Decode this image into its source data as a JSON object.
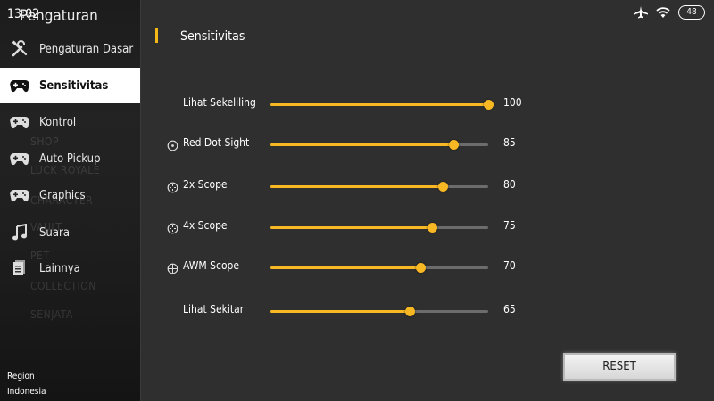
{
  "status_bar": {
    "time": "13:02",
    "battery": "48",
    "icons": [
      "airplane-icon",
      "wifi-icon",
      "battery-icon"
    ]
  },
  "sidebar": {
    "title": "Pengaturan",
    "background_texts": [
      "SHOP",
      "LUCK ROYALE",
      "CHARACTER",
      "VAULT",
      "PET",
      "COLLECTION",
      "SENJATA"
    ],
    "items": [
      {
        "label": "Pengaturan Dasar",
        "icon": "tools-icon",
        "active": false
      },
      {
        "label": "Sensitivitas",
        "icon": "gamepad-icon",
        "active": true
      },
      {
        "label": "Kontrol",
        "icon": "gamepad-icon",
        "active": false
      },
      {
        "label": "Auto Pickup",
        "icon": "gamepad-icon",
        "active": false
      },
      {
        "label": "Graphics",
        "icon": "gamepad-icon",
        "active": false
      },
      {
        "label": "Suara",
        "icon": "music-note-icon",
        "active": false
      },
      {
        "label": "Lainnya",
        "icon": "document-icon",
        "active": false
      }
    ],
    "region_label": "Region",
    "region_value": "Indonesia"
  },
  "main": {
    "section_title": "Sensitivitas",
    "sliders": [
      {
        "label": "Lihat Sekeliling",
        "value": "100",
        "fraction": 1.0,
        "icon": null
      },
      {
        "label": "Red Dot Sight",
        "value": "85",
        "fraction": 0.84,
        "icon": "red-dot-sight-icon"
      },
      {
        "label": "2x Scope",
        "value": "80",
        "fraction": 0.79,
        "icon": "scope-icon"
      },
      {
        "label": "4x Scope",
        "value": "75",
        "fraction": 0.74,
        "icon": "scope-icon"
      },
      {
        "label": "AWM Scope",
        "value": "70",
        "fraction": 0.69,
        "icon": "crosshair-icon"
      },
      {
        "label": "Lihat Sekitar",
        "value": "65",
        "fraction": 0.64,
        "icon": null
      }
    ],
    "reset_label": "RESET"
  },
  "colors": {
    "accent": "#f7b823",
    "track": "#6c6c6c",
    "panel": "#2f2f2f",
    "sidebar": "#1c1c1c"
  }
}
